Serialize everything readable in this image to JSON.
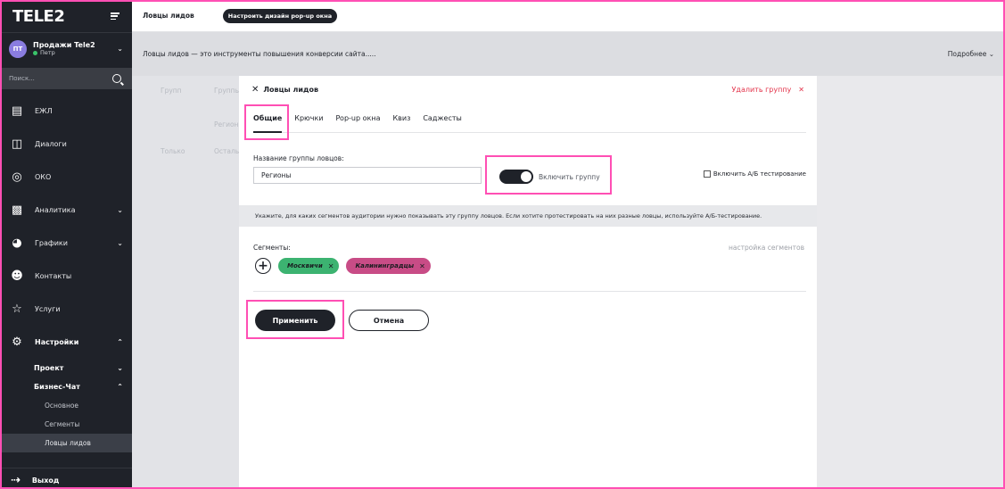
{
  "app": {
    "logo": "TELE2"
  },
  "account": {
    "initials": "ПТ",
    "name": "Продажи Tele2",
    "user": "Петр"
  },
  "sidebar": {
    "search_placeholder": "Поиск...",
    "items": [
      {
        "label": "ЕЖЛ",
        "icon": "document-icon"
      },
      {
        "label": "Диалоги",
        "icon": "chat-icon"
      },
      {
        "label": "ОКО",
        "icon": "eye-icon"
      },
      {
        "label": "Аналитика",
        "icon": "analytics-icon"
      },
      {
        "label": "Графики",
        "icon": "pie-chart-icon"
      },
      {
        "label": "Контакты",
        "icon": "contacts-icon"
      },
      {
        "label": "Услуги",
        "icon": "star-icon"
      },
      {
        "label": "Настройки",
        "icon": "gear-icon"
      }
    ],
    "sub": [
      {
        "label": "Проект"
      },
      {
        "label": "Бизнес-Чат"
      }
    ],
    "subsub": [
      {
        "label": "Основное"
      },
      {
        "label": "Сегменты"
      },
      {
        "label": "Ловцы лидов"
      }
    ],
    "logout": "Выход"
  },
  "topbar": {
    "title": "Ловцы лидов",
    "design_button": "Настроить дизайн pop-up окна"
  },
  "infobar": {
    "text": "Ловцы лидов — это инструменты повышения конверсии сайта.....",
    "more": "Подробнее"
  },
  "background": {
    "col1": "Групп",
    "col2": "Группы",
    "row1": "Регион",
    "row2a": "Только",
    "row2b": "Остальн"
  },
  "panel": {
    "title": "Ловцы лидов",
    "delete": "Удалить группу",
    "tabs": [
      "Общие",
      "Крючки",
      "Pop-up окна",
      "Квиз",
      "Саджесты"
    ],
    "name_label": "Название группы ловцов:",
    "name_value": "Регионы",
    "toggle_label": "Включить группу",
    "ab_label": "Включить А/Б тестирование",
    "hint": "Укажите, для каких сегментов аудитории нужно показывать эту группу ловцов. Если хотите протестировать на них разные ловцы, используйте А/Б-тестирование.",
    "segments_label": "Сегменты:",
    "segments_settings": "настройка сегментов",
    "segments": [
      {
        "label": "Москвичи"
      },
      {
        "label": "Калининградцы"
      }
    ],
    "apply": "Применить",
    "cancel": "Отмена"
  },
  "colors": {
    "accent": "#1f2229",
    "highlight": "#ff4fb4",
    "chip_green": "#3cb371",
    "chip_magenta": "#c84c86",
    "danger": "#e3344b"
  }
}
